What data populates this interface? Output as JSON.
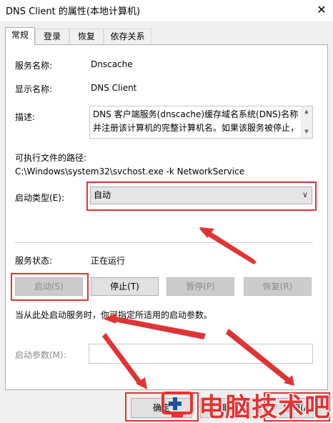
{
  "window": {
    "title": "DNS Client 的属性(本地计算机)",
    "close_glyph": "✕"
  },
  "tabs": [
    {
      "label": "常规",
      "active": true
    },
    {
      "label": "登录",
      "active": false
    },
    {
      "label": "恢复",
      "active": false
    },
    {
      "label": "依存关系",
      "active": false
    }
  ],
  "general": {
    "service_name_label": "服务名称:",
    "service_name_value": "Dnscache",
    "display_name_label": "显示名称:",
    "display_name_value": "DNS Client",
    "description_label": "描述:",
    "description_lines": [
      "DNS 客户端服务(dnscache)缓存域名系统(DNS)名称",
      "并注册该计算机的完整计算机名。如果该服务被停止，"
    ],
    "exe_path_label": "可执行文件的路径:",
    "exe_path_value": "C:\\Windows\\system32\\svchost.exe -k NetworkService",
    "startup_type_label": "启动类型(E):",
    "startup_type_value": "自动",
    "status_label": "服务状态:",
    "status_value": "正在运行",
    "buttons": {
      "start": "启动(S)",
      "stop": "停止(T)",
      "pause": "暂停(P)",
      "resume": "恢复(R)"
    },
    "hint_text": "当从此处启动服务时，你可指定所适用的启动参数。",
    "start_params_label": "启动参数(M):",
    "start_params_value": ""
  },
  "footer": {
    "ok": "确定",
    "cancel": "取消",
    "apply": "应用(A)"
  },
  "watermark": {
    "text": "电脑技术吧"
  },
  "colors": {
    "annotation_red": "#e03434",
    "watermark_red": "#e63232"
  },
  "icons": {
    "dropdown": "chevron-down-icon",
    "scroll_up": "scroll-up-icon",
    "scroll_down": "scroll-down-icon",
    "close": "close-icon",
    "watermark_logo": "monitor-plus-logo"
  }
}
